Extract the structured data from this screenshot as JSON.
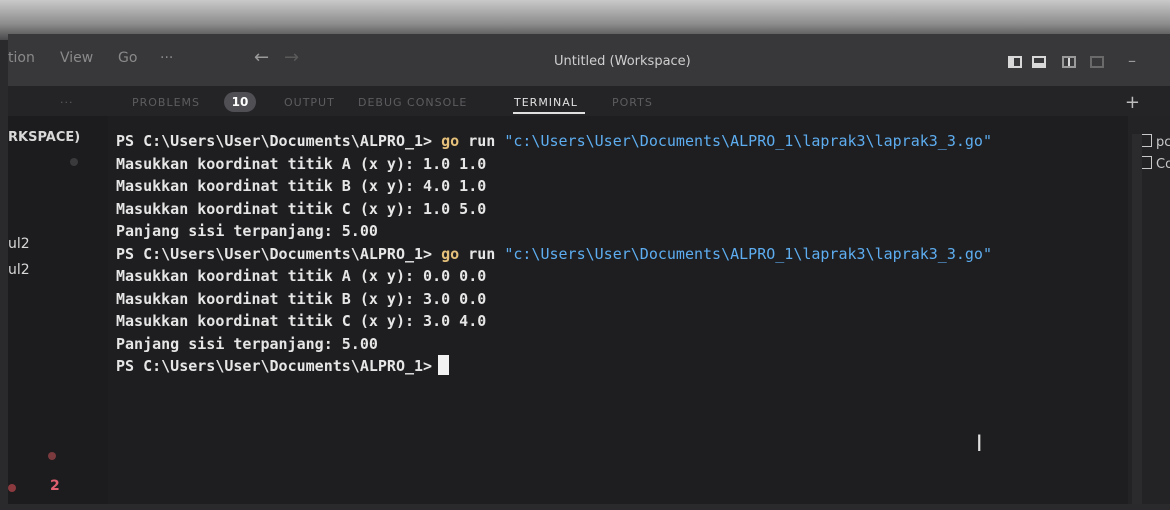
{
  "titlebar": {
    "menu": [
      "tion",
      "View",
      "Go",
      "···"
    ],
    "title": "Untitled (Workspace)",
    "back_arrow": "←",
    "forward_arrow": "→",
    "minimize": "–"
  },
  "panel": {
    "overflow": "···",
    "tabs": [
      "PROBLEMS",
      "OUTPUT",
      "DEBUG CONSOLE",
      "TERMINAL",
      "PORTS"
    ],
    "active_tab": "TERMINAL",
    "problems_count": "10",
    "add_label": "+"
  },
  "sidebar": {
    "workspace_label": "RKSPACE)",
    "items": [
      "ul2",
      "ul2"
    ],
    "bottom_count": "2"
  },
  "terminal": {
    "prompt": "PS C:\\Users\\User\\Documents\\ALPRO_1>",
    "command_keyword": "go",
    "command_verb": "run",
    "command_path": "\"c:\\Users\\User\\Documents\\ALPRO_1\\laprak3\\laprak3_3.go\"",
    "run1": [
      "Masukkan koordinat titik A (x y): 1.0 1.0",
      "Masukkan koordinat titik B (x y): 4.0 1.0",
      "Masukkan koordinat titik C (x y): 1.0 5.0",
      "Panjang sisi terpanjang: 5.00"
    ],
    "run2": [
      "Masukkan koordinat titik A (x y): 0.0 0.0",
      "Masukkan koordinat titik B (x y): 3.0 0.0",
      "Masukkan koordinat titik C (x y): 3.0 4.0",
      "Panjang sisi terpanjang: 5.00"
    ]
  },
  "right_panel": {
    "items": [
      "pc",
      "Co"
    ]
  },
  "colors": {
    "keyword": "#e5c07b",
    "string": "#5dadf0",
    "terminal_text": "#e6e6e6",
    "background": "#1e1e20"
  }
}
